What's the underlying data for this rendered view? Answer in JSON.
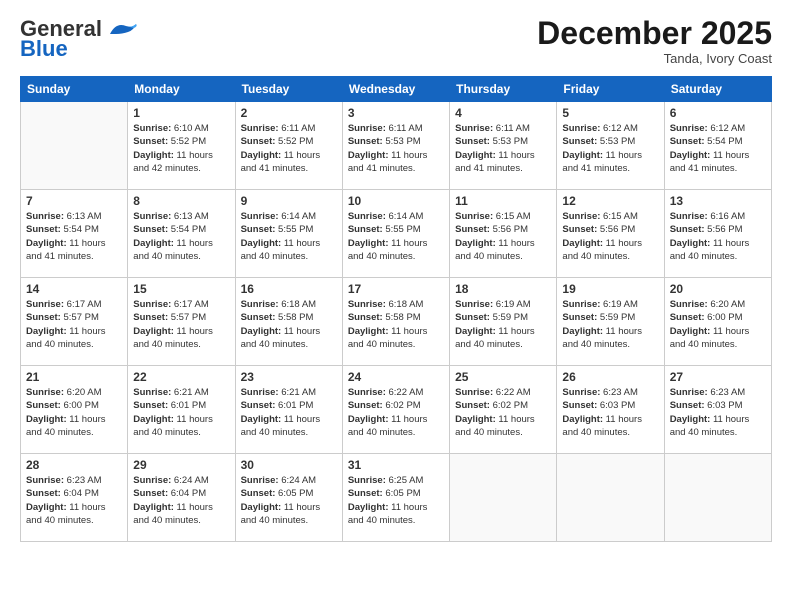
{
  "header": {
    "logo_line1": "General",
    "logo_line2": "Blue",
    "month": "December 2025",
    "location": "Tanda, Ivory Coast"
  },
  "weekdays": [
    "Sunday",
    "Monday",
    "Tuesday",
    "Wednesday",
    "Thursday",
    "Friday",
    "Saturday"
  ],
  "weeks": [
    [
      {
        "day": "",
        "sunrise": "",
        "sunset": "",
        "daylight": ""
      },
      {
        "day": "1",
        "sunrise": "6:10 AM",
        "sunset": "5:52 PM",
        "daylight": "11 hours and 42 minutes."
      },
      {
        "day": "2",
        "sunrise": "6:11 AM",
        "sunset": "5:52 PM",
        "daylight": "11 hours and 41 minutes."
      },
      {
        "day": "3",
        "sunrise": "6:11 AM",
        "sunset": "5:53 PM",
        "daylight": "11 hours and 41 minutes."
      },
      {
        "day": "4",
        "sunrise": "6:11 AM",
        "sunset": "5:53 PM",
        "daylight": "11 hours and 41 minutes."
      },
      {
        "day": "5",
        "sunrise": "6:12 AM",
        "sunset": "5:53 PM",
        "daylight": "11 hours and 41 minutes."
      },
      {
        "day": "6",
        "sunrise": "6:12 AM",
        "sunset": "5:54 PM",
        "daylight": "11 hours and 41 minutes."
      }
    ],
    [
      {
        "day": "7",
        "sunrise": "6:13 AM",
        "sunset": "5:54 PM",
        "daylight": "11 hours and 41 minutes."
      },
      {
        "day": "8",
        "sunrise": "6:13 AM",
        "sunset": "5:54 PM",
        "daylight": "11 hours and 40 minutes."
      },
      {
        "day": "9",
        "sunrise": "6:14 AM",
        "sunset": "5:55 PM",
        "daylight": "11 hours and 40 minutes."
      },
      {
        "day": "10",
        "sunrise": "6:14 AM",
        "sunset": "5:55 PM",
        "daylight": "11 hours and 40 minutes."
      },
      {
        "day": "11",
        "sunrise": "6:15 AM",
        "sunset": "5:56 PM",
        "daylight": "11 hours and 40 minutes."
      },
      {
        "day": "12",
        "sunrise": "6:15 AM",
        "sunset": "5:56 PM",
        "daylight": "11 hours and 40 minutes."
      },
      {
        "day": "13",
        "sunrise": "6:16 AM",
        "sunset": "5:56 PM",
        "daylight": "11 hours and 40 minutes."
      }
    ],
    [
      {
        "day": "14",
        "sunrise": "6:17 AM",
        "sunset": "5:57 PM",
        "daylight": "11 hours and 40 minutes."
      },
      {
        "day": "15",
        "sunrise": "6:17 AM",
        "sunset": "5:57 PM",
        "daylight": "11 hours and 40 minutes."
      },
      {
        "day": "16",
        "sunrise": "6:18 AM",
        "sunset": "5:58 PM",
        "daylight": "11 hours and 40 minutes."
      },
      {
        "day": "17",
        "sunrise": "6:18 AM",
        "sunset": "5:58 PM",
        "daylight": "11 hours and 40 minutes."
      },
      {
        "day": "18",
        "sunrise": "6:19 AM",
        "sunset": "5:59 PM",
        "daylight": "11 hours and 40 minutes."
      },
      {
        "day": "19",
        "sunrise": "6:19 AM",
        "sunset": "5:59 PM",
        "daylight": "11 hours and 40 minutes."
      },
      {
        "day": "20",
        "sunrise": "6:20 AM",
        "sunset": "6:00 PM",
        "daylight": "11 hours and 40 minutes."
      }
    ],
    [
      {
        "day": "21",
        "sunrise": "6:20 AM",
        "sunset": "6:00 PM",
        "daylight": "11 hours and 40 minutes."
      },
      {
        "day": "22",
        "sunrise": "6:21 AM",
        "sunset": "6:01 PM",
        "daylight": "11 hours and 40 minutes."
      },
      {
        "day": "23",
        "sunrise": "6:21 AM",
        "sunset": "6:01 PM",
        "daylight": "11 hours and 40 minutes."
      },
      {
        "day": "24",
        "sunrise": "6:22 AM",
        "sunset": "6:02 PM",
        "daylight": "11 hours and 40 minutes."
      },
      {
        "day": "25",
        "sunrise": "6:22 AM",
        "sunset": "6:02 PM",
        "daylight": "11 hours and 40 minutes."
      },
      {
        "day": "26",
        "sunrise": "6:23 AM",
        "sunset": "6:03 PM",
        "daylight": "11 hours and 40 minutes."
      },
      {
        "day": "27",
        "sunrise": "6:23 AM",
        "sunset": "6:03 PM",
        "daylight": "11 hours and 40 minutes."
      }
    ],
    [
      {
        "day": "28",
        "sunrise": "6:23 AM",
        "sunset": "6:04 PM",
        "daylight": "11 hours and 40 minutes."
      },
      {
        "day": "29",
        "sunrise": "6:24 AM",
        "sunset": "6:04 PM",
        "daylight": "11 hours and 40 minutes."
      },
      {
        "day": "30",
        "sunrise": "6:24 AM",
        "sunset": "6:05 PM",
        "daylight": "11 hours and 40 minutes."
      },
      {
        "day": "31",
        "sunrise": "6:25 AM",
        "sunset": "6:05 PM",
        "daylight": "11 hours and 40 minutes."
      },
      {
        "day": "",
        "sunrise": "",
        "sunset": "",
        "daylight": ""
      },
      {
        "day": "",
        "sunrise": "",
        "sunset": "",
        "daylight": ""
      },
      {
        "day": "",
        "sunrise": "",
        "sunset": "",
        "daylight": ""
      }
    ]
  ],
  "labels": {
    "sunrise": "Sunrise:",
    "sunset": "Sunset:",
    "daylight": "Daylight:"
  }
}
